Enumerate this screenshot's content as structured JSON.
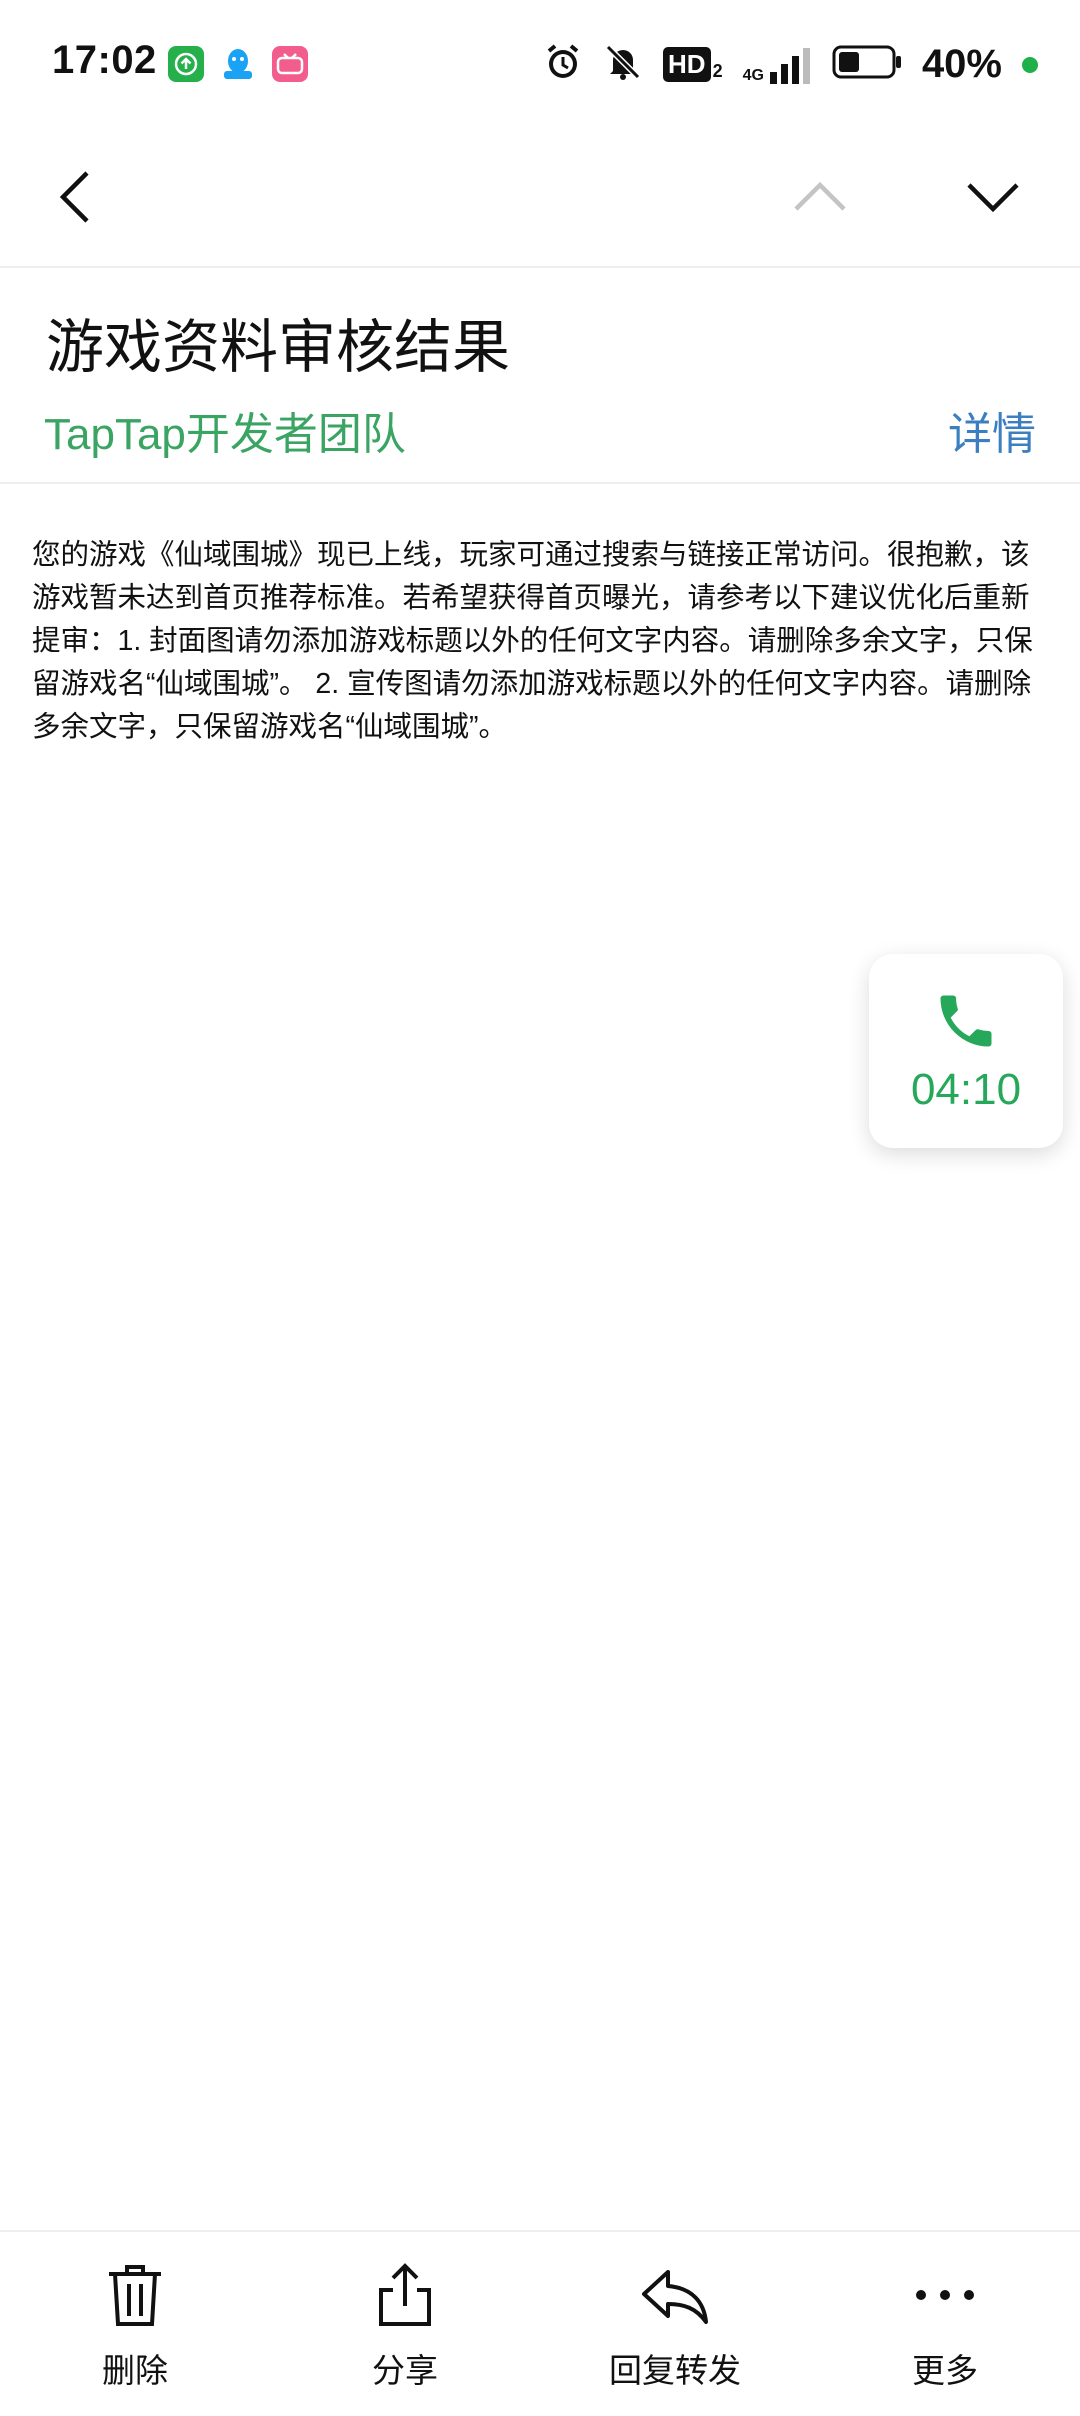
{
  "status_bar": {
    "time": "17:02",
    "battery": "40%",
    "network": "4G",
    "hd_badge": "HD",
    "hd_sub": "2",
    "icons": [
      "app-upload-icon",
      "app-qq-icon",
      "app-bilibili-icon",
      "alarm-icon",
      "bell-off-icon",
      "signal-icon",
      "battery-icon"
    ],
    "colors": {
      "upload_app": "#25b04b",
      "bilibili": "#f25d8e",
      "qq": "#1aa3f5",
      "dot": "#1fb04b"
    }
  },
  "nav": {
    "icons": [
      "back-chevron-icon",
      "previous-mail-chevron-up-icon",
      "next-mail-chevron-down-icon"
    ]
  },
  "mail": {
    "title": "游戏资料审核结果",
    "sender": "TapTap开发者团队",
    "details_label": "详情",
    "body": "您的游戏《仙域围城》现已上线，玩家可通过搜索与链接正常访问。很抱歉，该游戏暂未达到首页推荐标准。若希望获得首页曝光，请参考以下建议优化后重新提审：1. 封面图请勿添加游戏标题以外的任何文字内容。请删除多余文字，只保留游戏名“仙域围城”。 2. 宣传图请勿添加游戏标题以外的任何文字内容。请删除多余文字，只保留游戏名“仙域围城”。"
  },
  "call": {
    "duration": "04:10",
    "color": "#26a85a"
  },
  "toolbar": {
    "delete_label": "删除",
    "share_label": "分享",
    "reply_label": "回复转发",
    "more_label": "更多"
  }
}
